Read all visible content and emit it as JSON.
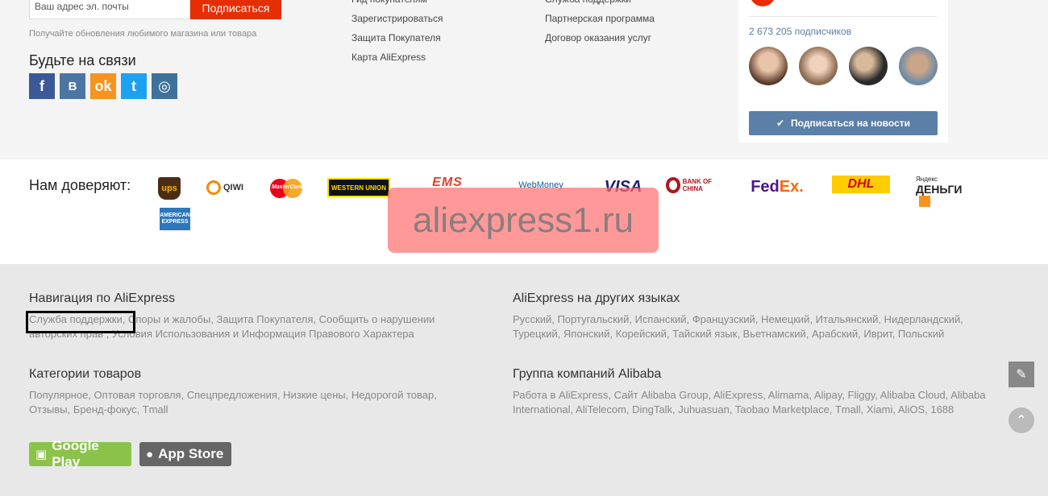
{
  "subscribe": {
    "email_placeholder": "Ваш адрес эл. почты",
    "button": "Подписаться",
    "hint": "Получайте обновления любимого магазина или товара"
  },
  "social": {
    "title": "Будьте на связи",
    "items": [
      {
        "name": "facebook",
        "glyph": "f"
      },
      {
        "name": "vkontakte",
        "glyph": "B"
      },
      {
        "name": "odnoklassniki",
        "glyph": "ok"
      },
      {
        "name": "twitter",
        "glyph": "t"
      },
      {
        "name": "instagram",
        "glyph": "◎"
      }
    ]
  },
  "links": {
    "col1": [
      "Гид покупателям",
      "Зарегистрироваться",
      "Защита Покупателя",
      "Карта AliExpress"
    ],
    "col2": [
      "Служба поддержки",
      "Партнерская программа",
      "Договор оказания услуг"
    ]
  },
  "vk_widget": {
    "subscribers": "2 673 205 подписчиков",
    "button": "Подписаться на новости",
    "button_icon": "vk-icon"
  },
  "trust": {
    "title": "Нам доверяют:",
    "logos": {
      "ups": "ups",
      "qiwi": "QIWI",
      "mastercard": "MasterCard",
      "western_union": "WESTERN UNION",
      "ems": "EMS",
      "webmoney": "WebMoney",
      "visa": "VISA",
      "bank_of_china": "BANK OF CHINA",
      "fedex_fed": "Fed",
      "fedex_ex": "Ex.",
      "dhl": "DHL",
      "yandex_small": "Яндекс",
      "yandex_big": "ДЕНЬГИ",
      "amex": "AMERICAN EXPRESS"
    }
  },
  "watermark": "aliexpress1.ru",
  "footer": {
    "nav": {
      "title": "Навигация по AliExpress",
      "text": "Служба поддержки, Споры и жалобы, Защита Покупателя, Сообщить о нарушении авторских прав , Условия Использования и Информация Правового Характера"
    },
    "languages": {
      "title": "AliExpress на других языках",
      "text": "Русский, Португальский, Испанский, Французский, Немецкий, Итальянский, Нидерландский, Турецкий, Японский, Корейский, Тайский язык, Вьетнамский, Арабский, Иврит, Польский"
    },
    "categories": {
      "title": "Категории товаров",
      "text": "Популярное, Оптовая торговля, Спецпредложения, Низкие цены, Недорогой товар, Отзывы, Бренд-фокус, Tmall"
    },
    "alibaba": {
      "title": "Группа компаний Alibaba",
      "text": "Работа в AliExpress, Сайт Alibaba Group, AliExpress, Alimama, Alipay, Fliggy, Alibaba Cloud, Alibaba International, AliTelecom, DingTalk, Juhuasuan, Taobao Marketplace, Tmall, Xiami, AliOS, 1688"
    }
  },
  "stores": {
    "google_play": "Google Play",
    "app_store": "App Store"
  },
  "colors": {
    "accent": "#e62e04",
    "vk_button": "#5b7fa6",
    "google_play": "#8bc34a",
    "app_store": "#666666"
  }
}
